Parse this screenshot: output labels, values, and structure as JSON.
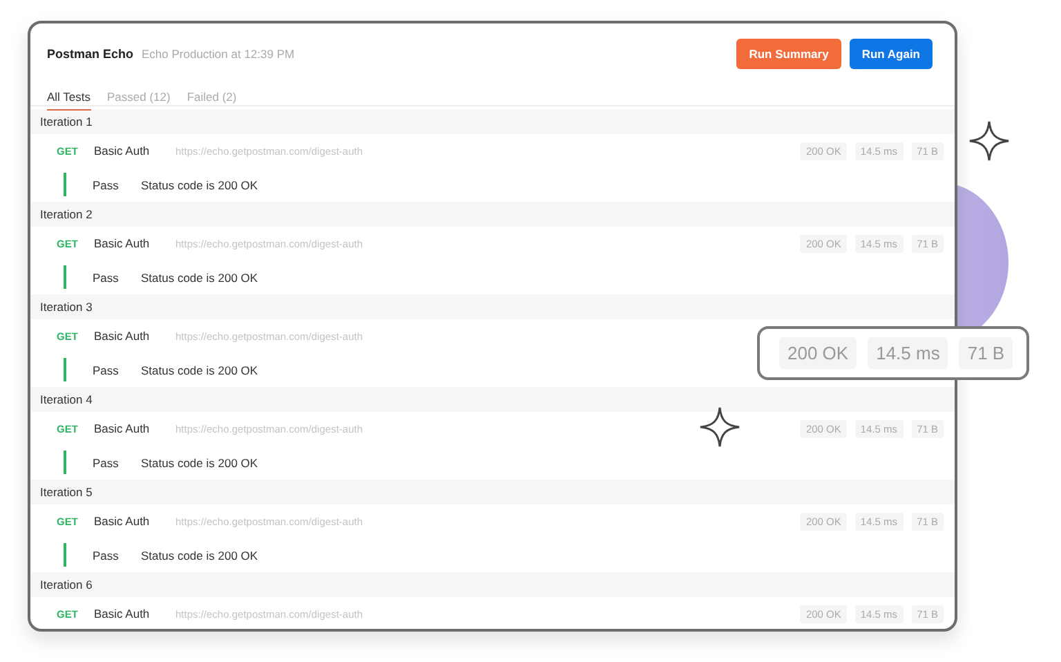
{
  "header": {
    "title": "Postman Echo",
    "subtitle": "Echo Production at 12:39 PM"
  },
  "buttons": [
    {
      "label": "Run Summary",
      "kind": "summary"
    },
    {
      "label": "Run Again",
      "kind": "primary"
    }
  ],
  "tabs": [
    {
      "label": "All Tests",
      "selected": true
    },
    {
      "label": "Passed (12)",
      "selected": false
    },
    {
      "label": "Failed (2)",
      "selected": false
    }
  ],
  "iterations": [
    {
      "title": "Iteration 1",
      "requests": [
        {
          "method": "GET",
          "name": "Basic Auth",
          "url": "https://echo.getpostman.com/digest-auth",
          "metrics": [
            "200 OK",
            "14.5 ms",
            "71 B"
          ],
          "tests": [
            {
              "result": "Pass",
              "passed": true,
              "message": "Status code is 200 OK"
            }
          ]
        }
      ]
    },
    {
      "title": "Iteration 2",
      "requests": [
        {
          "method": "GET",
          "name": "Basic Auth",
          "url": "https://echo.getpostman.com/digest-auth",
          "metrics": [
            "200 OK",
            "14.5 ms",
            "71 B"
          ],
          "tests": [
            {
              "result": "Pass",
              "passed": true,
              "message": "Status code is 200 OK"
            }
          ]
        }
      ]
    },
    {
      "title": "Iteration 3",
      "requests": [
        {
          "method": "GET",
          "name": "Basic Auth",
          "url": "https://echo.getpostman.com/digest-auth",
          "tests": [
            {
              "result": "Pass",
              "passed": true,
              "message": "Status code is 200 OK"
            }
          ]
        }
      ]
    },
    {
      "title": "Iteration 4",
      "requests": [
        {
          "method": "GET",
          "name": "Basic Auth",
          "url": "https://echo.getpostman.com/digest-auth",
          "metrics": [
            "200 OK",
            "14.5 ms",
            "71 B"
          ],
          "tests": [
            {
              "result": "Pass",
              "passed": true,
              "message": "Status code is 200 OK"
            }
          ]
        }
      ]
    },
    {
      "title": "Iteration 5",
      "requests": [
        {
          "method": "GET",
          "name": "Basic Auth",
          "url": "https://echo.getpostman.com/digest-auth",
          "metrics": [
            "200 OK",
            "14.5 ms",
            "71 B"
          ],
          "tests": [
            {
              "result": "Pass",
              "passed": true,
              "message": "Status code is 200 OK"
            }
          ]
        }
      ]
    },
    {
      "title": "Iteration 6",
      "requests": [
        {
          "method": "GET",
          "name": "Basic Auth",
          "url": "https://echo.getpostman.com/digest-auth",
          "metrics": [
            "200 OK",
            "14.5 ms",
            "71 B"
          ]
        }
      ]
    }
  ],
  "callout": {
    "metrics": [
      "200 OK",
      "14.5 ms",
      "71 B"
    ]
  }
}
